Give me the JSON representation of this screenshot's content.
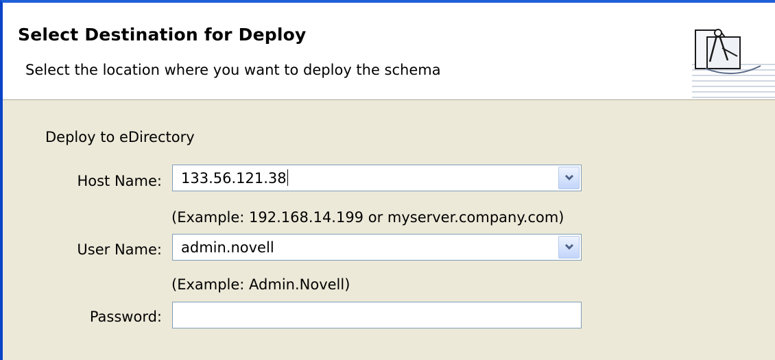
{
  "header": {
    "title": "Select Destination for Deploy",
    "description": "Select the location where you want to deploy the schema",
    "graphic_icon": "wizard-compass-icon"
  },
  "form": {
    "section_label": "Deploy to eDirectory",
    "host": {
      "label": "Host Name:",
      "value": "133.56.121.38",
      "hint": "(Example: 192.168.14.199 or myserver.company.com)"
    },
    "user": {
      "label": "User Name:",
      "value": "admin.novell",
      "hint": "(Example:  Admin.Novell)"
    },
    "password": {
      "label": "Password:",
      "value": ""
    }
  },
  "colors": {
    "dialog_bg": "#ece9d8",
    "banner_bg": "#ffffff",
    "window_border": "#0a43c8",
    "field_border": "#7f9db9"
  }
}
